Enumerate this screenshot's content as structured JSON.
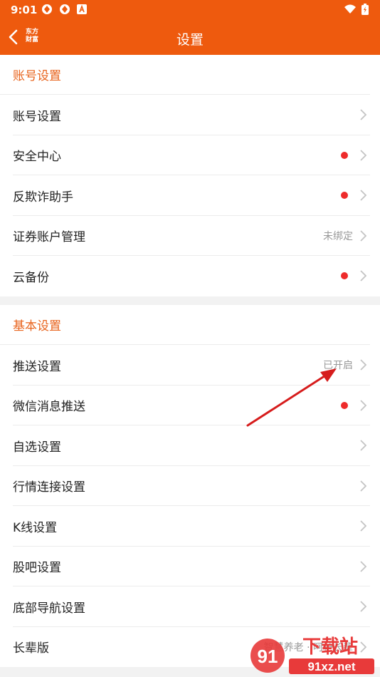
{
  "status": {
    "time": "9:01"
  },
  "nav": {
    "logo_line1": "东方",
    "logo_line2": "财富",
    "title": "设置"
  },
  "sections": [
    {
      "header": "账号设置",
      "rows": [
        {
          "label": "账号设置"
        },
        {
          "label": "安全中心",
          "dot": true
        },
        {
          "label": "反欺诈助手",
          "dot": true
        },
        {
          "label": "证券账户管理",
          "value": "未绑定"
        },
        {
          "label": "云备份",
          "dot": true
        }
      ]
    },
    {
      "header": "基本设置",
      "rows": [
        {
          "label": "推送设置",
          "value": "已开启"
        },
        {
          "label": "微信消息推送",
          "dot": true
        },
        {
          "label": "自选设置"
        },
        {
          "label": "行情连接设置"
        },
        {
          "label": "K线设置"
        },
        {
          "label": "股吧设置"
        },
        {
          "label": "底部导航设置"
        },
        {
          "label": "长辈版",
          "value": "智慧养老 · 呵护长辈"
        }
      ]
    }
  ],
  "watermark": {
    "text": "下载站",
    "url": "91xz.net"
  },
  "colors": {
    "brand": "#ee5a0e",
    "section_header": "#e8631c",
    "dot": "#ee2b2b"
  }
}
